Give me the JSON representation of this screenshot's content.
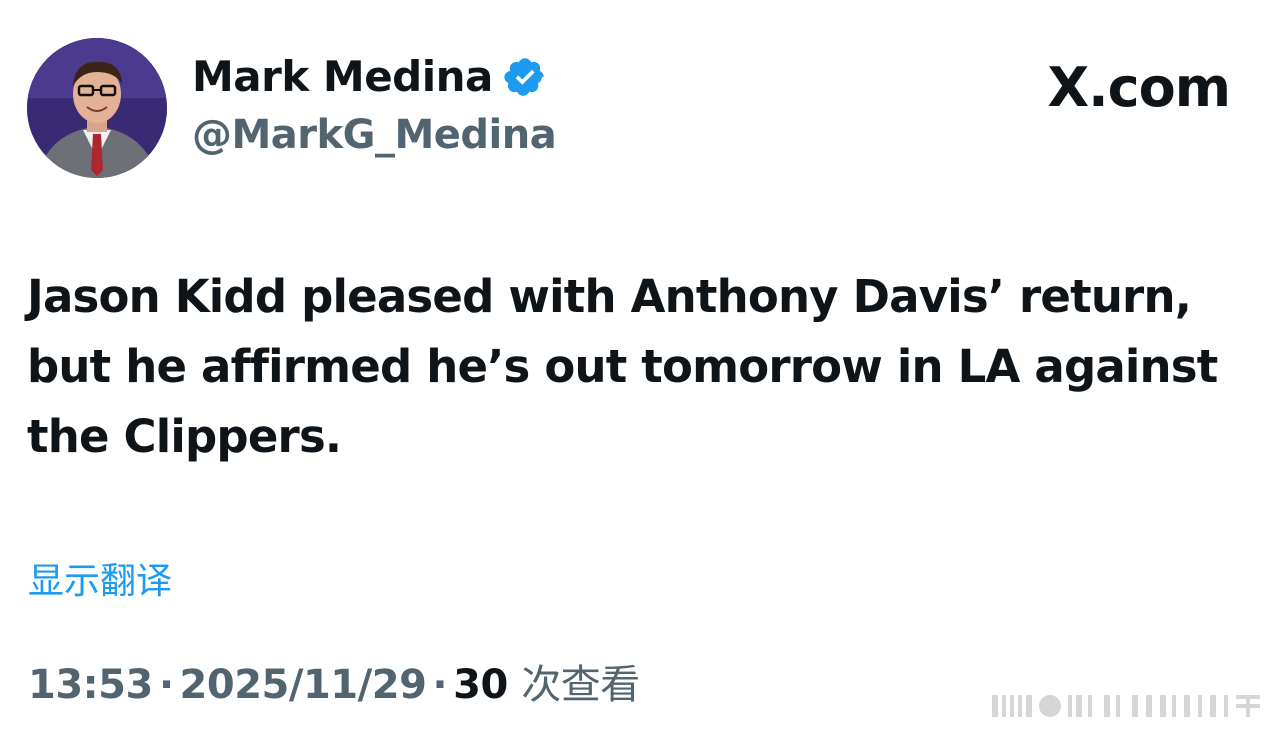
{
  "author": {
    "display_name": "Mark Medina",
    "handle": "@MarkG_Medina",
    "verified_icon": "verified-badge-icon"
  },
  "brand": {
    "label": "X.com"
  },
  "tweet": {
    "text": "Jason Kidd pleased with Anthony Davis’ return, but he affirmed he’s out tomorrow in LA against the Clippers.",
    "translate_label": "显示翻译"
  },
  "meta": {
    "time": "13:53",
    "date": "2025/11/29",
    "views_count": "30",
    "views_label": "次查看",
    "separator": "·"
  },
  "colors": {
    "accent": "#1d9bf0",
    "secondary_text": "#536471",
    "primary_text": "#0f1419"
  }
}
